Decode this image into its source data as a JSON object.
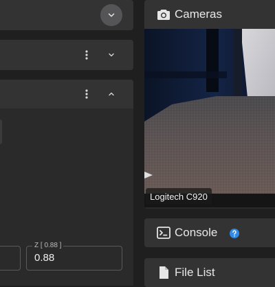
{
  "cameras": {
    "title": "Cameras",
    "camera_name": "Logitech C920"
  },
  "console": {
    "title": "Console"
  },
  "file_list": {
    "title": "File List"
  },
  "z_field": {
    "label": "Z [ 0.88 ]",
    "value": "0.88"
  },
  "icons": {
    "top_expand": "chevron-down-icon",
    "panel2_menu": "more-vert-icon",
    "panel2_expand": "chevron-down-icon",
    "panel3_menu": "more-vert-icon",
    "panel3_collapse": "chevron-up-icon",
    "cameras": "camera-icon",
    "console": "terminal-icon",
    "console_help": "help-circle-icon",
    "file_list": "file-icon"
  },
  "colors": {
    "accent_help": "#2f8be6",
    "panel_bg": "#2a2a2b",
    "header_bg": "#333334"
  }
}
